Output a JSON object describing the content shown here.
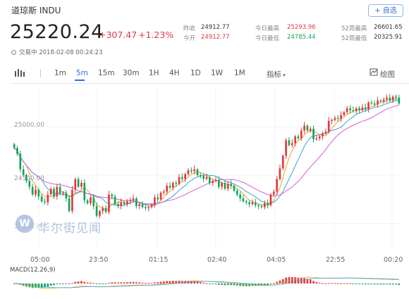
{
  "header": {
    "title": "道琼斯  INDU",
    "add_label": "+ 自选",
    "price": "25220.24",
    "change": "+307.47",
    "change_pct": "+1.23%",
    "status": "交易中 2018-02-08 00:24:23"
  },
  "stats": {
    "prev_close_label": "昨收",
    "prev_close": "24912.77",
    "open_label": "今开",
    "open": "24912.77",
    "high_label": "今日最高",
    "high": "25293.96",
    "low_label": "今日最低",
    "low": "24785.44",
    "w52_high_label": "52周最高",
    "w52_high": "26601.65",
    "w52_low_label": "52周最低",
    "w52_low": "20325.91"
  },
  "toolbar": {
    "intervals": [
      "1m",
      "5m",
      "15m",
      "30m",
      "1H",
      "4H",
      "1D",
      "1W",
      "1M"
    ],
    "active_interval": "5m",
    "indicators_label": "指标",
    "draw_label": "绘图"
  },
  "chart": {
    "y_labels": [
      "25000.00",
      "24500.00",
      "24000.00"
    ],
    "x_labels": [
      "05:00",
      "23:50",
      "01:15",
      "02:40",
      "04:05",
      "22:55",
      "00:20"
    ],
    "macd_label": "MACD(12,26,9)",
    "watermark": "华尔街见闻",
    "colors": {
      "up": "#e0393e",
      "down": "#13a55b",
      "ma1": "#f0a030",
      "ma2": "#3aa0d8",
      "ma3": "#d25fd2"
    }
  },
  "chart_data": {
    "type": "candlestick",
    "x_ticks": [
      "05:00",
      "23:50",
      "01:15",
      "02:40",
      "04:05",
      "22:55",
      "00:20"
    ],
    "y_ticks": [
      25000,
      24500,
      24000
    ],
    "ylim": [
      23730,
      25400
    ],
    "closes": [
      24780,
      24720,
      24560,
      24500,
      24440,
      24380,
      24300,
      24350,
      24280,
      24230,
      24220,
      24300,
      24360,
      24280,
      24380,
      24310,
      24320,
      24260,
      24130,
      24350,
      24460,
      24380,
      24420,
      24240,
      24210,
      24270,
      24180,
      24080,
      24130,
      24160,
      24120,
      24300,
      24280,
      24200,
      24180,
      24220,
      24200,
      24230,
      24240,
      24260,
      24180,
      24200,
      24170,
      24160,
      24170,
      24190,
      24270,
      24250,
      24320,
      24330,
      24390,
      24370,
      24420,
      24410,
      24480,
      24460,
      24510,
      24550,
      24540,
      24560,
      24500,
      24490,
      24460,
      24480,
      24420,
      24440,
      24450,
      24380,
      24420,
      24360,
      24410,
      24390,
      24340,
      24300,
      24260,
      24230,
      24220,
      24200,
      24220,
      24190,
      24180,
      24170,
      24210,
      24190,
      24300,
      24330,
      24460,
      24570,
      24700,
      24860,
      24810,
      24830,
      24900,
      24880,
      24960,
      25010,
      24960,
      24980,
      24870,
      24880,
      24900,
      24930,
      24950,
      25060,
      25070,
      25090,
      25080,
      25120,
      25150,
      25190,
      25170,
      25160,
      25190,
      25170,
      25200,
      25180,
      25250,
      25240,
      25230,
      25270,
      25260,
      25280,
      25300,
      25270,
      25310,
      25300,
      25240
    ]
  }
}
